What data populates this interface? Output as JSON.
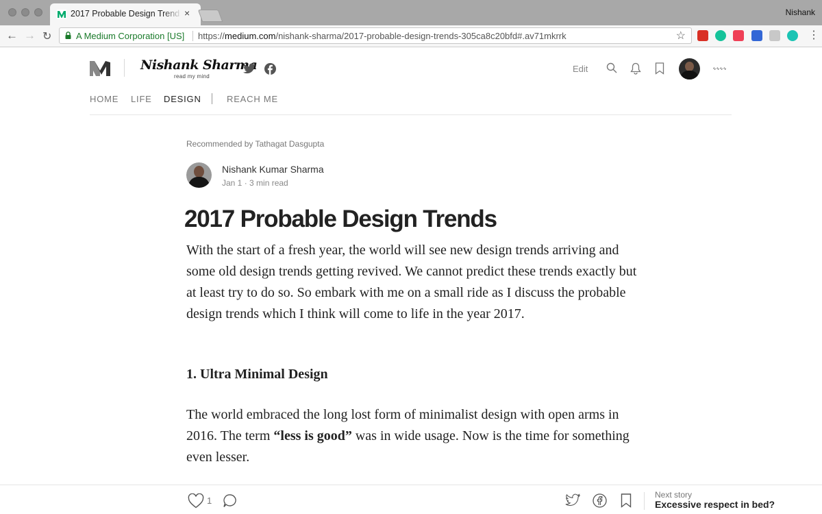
{
  "browser": {
    "tab_title": "2017 Probable Design Trends",
    "tab_close": "×",
    "profile_name": "Nishank",
    "secure_label": "A Medium Corporation [US]",
    "url_scheme": "https://",
    "url_host": "medium.com",
    "url_path": "/nishank-sharma/2017-probable-design-trends-305ca8c20bfd#.av71mkrrk",
    "extensions": [
      {
        "name": "readwise-extension-icon",
        "color": "#d93025"
      },
      {
        "name": "grammarly-extension-icon",
        "color": "#15c39a"
      },
      {
        "name": "pocket-extension-icon",
        "color": "#ef3f56"
      },
      {
        "name": "bookmark-extension-icon",
        "color": "#3367d6"
      },
      {
        "name": "evernote-extension-icon",
        "color": "#c8c8c8"
      },
      {
        "name": "mercury-extension-icon",
        "color": "#1bc4b4"
      }
    ]
  },
  "publication": {
    "name": "Nishank Sharma",
    "tagline": "read my mind",
    "edit_label": "Edit",
    "signature": "Nishank Sharma",
    "nav": [
      {
        "label": "HOME",
        "active": false
      },
      {
        "label": "LIFE",
        "active": false
      },
      {
        "label": "DESIGN",
        "active": true
      },
      {
        "label": "REACH ME",
        "active": false
      }
    ]
  },
  "article": {
    "recommended": "Recommended by Tathagat Dasgupta",
    "author": "Nishank Kumar Sharma",
    "date": "Jan 1",
    "read_time": "3 min read",
    "title": "2017 Probable Design Trends",
    "intro": "With the start of a fresh year, the world will see new design trends arriving and some old design trends getting revived. We cannot predict these trends exactly but at least try to do so. So embark with me on a small ride as I discuss the probable design trends which I think will come to life in the year 2017.",
    "section1_heading": "1. Ultra Minimal Design",
    "section1_before": "The world embraced the long lost form of minimalist design with open arms in 2016. The term ",
    "section1_bold": "“less is good”",
    "section1_after": " was in wide usage. Now is the time for something even lesser."
  },
  "action_bar": {
    "clap_count": "1",
    "next_label": "Next story",
    "next_title": "Excessive respect in bed?"
  },
  "colors": {
    "accent_green": "#1a7a2a",
    "medium_green": "#00ab6c"
  }
}
